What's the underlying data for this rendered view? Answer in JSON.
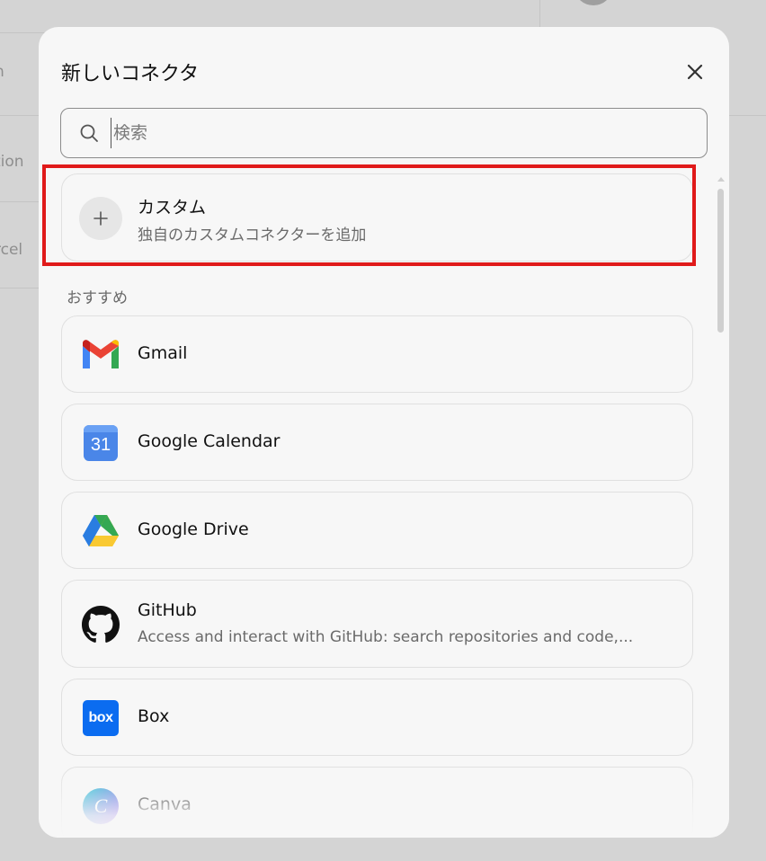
{
  "background": {
    "items": [
      "n",
      "tion",
      "rcel"
    ]
  },
  "modal": {
    "title": "新しいコネクタ",
    "close_icon": "close-icon"
  },
  "search": {
    "placeholder": "検索",
    "value": ""
  },
  "custom": {
    "name": "カスタム",
    "description": "独自のカスタムコネクターを追加",
    "icon": "plus-icon"
  },
  "recommended": {
    "label": "おすすめ",
    "items": [
      {
        "name": "Gmail",
        "icon": "gmail-icon"
      },
      {
        "name": "Google Calendar",
        "icon": "google-calendar-icon",
        "icon_text": "31"
      },
      {
        "name": "Google Drive",
        "icon": "google-drive-icon"
      },
      {
        "name": "GitHub",
        "description": "Access and interact with GitHub: search repositories and code,...",
        "icon": "github-icon"
      },
      {
        "name": "Box",
        "icon": "box-icon",
        "icon_text": "box"
      },
      {
        "name": "Canva",
        "icon": "canva-icon",
        "icon_text": "C"
      }
    ]
  },
  "colors": {
    "highlight": "#e01a1a",
    "modal_bg": "#f7f7f7",
    "overlay_bg": "#d4d4d4"
  }
}
